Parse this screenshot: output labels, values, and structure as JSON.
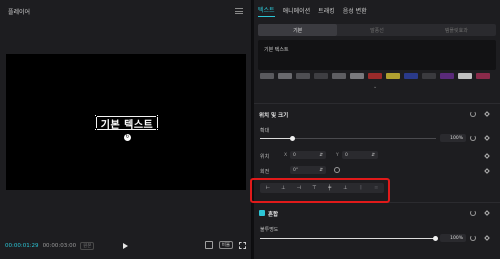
{
  "player": {
    "title": "플레이어",
    "canvas_text": "기본 텍스트",
    "timecode_current": "00:00:01:29",
    "timecode_total": "00:00:03:00",
    "quality_badge": "원본",
    "ratio_label": "비율"
  },
  "panel": {
    "tabs": [
      {
        "label": "텍스트",
        "active": true
      },
      {
        "label": "애니메이션",
        "active": false
      },
      {
        "label": "트래킹",
        "active": false
      },
      {
        "label": "음성 변환",
        "active": false
      }
    ],
    "subtabs": [
      {
        "label": "기본",
        "active": true
      },
      {
        "label": "말풍선",
        "active": false
      },
      {
        "label": "템플릿효과",
        "active": false
      }
    ],
    "text_value": "기본 텍스트",
    "swatch_colors": [
      "#5a5a5e",
      "#6a6a6e",
      "#4e4e52",
      "#3e3e42",
      "#5e5e62",
      "#7a7a7e",
      "#9a2a2a",
      "#b0a030",
      "#2a3a8a",
      "#3a3a3e",
      "#5a2a7a",
      "#c0c0c0",
      "#8a2a4a"
    ],
    "position_size": {
      "title": "위치 및 크기",
      "scale_label": "확대",
      "scale_value": "100%",
      "scale_level": 0.18,
      "position_label": "위치",
      "x_axis": "X",
      "x_value": "0",
      "y_axis": "Y",
      "y_value": "0",
      "rotation_label": "회전",
      "rotation_value": "0°"
    },
    "align_icons": [
      "align-left-icon",
      "align-hcenter-icon",
      "align-right-icon",
      "align-top-icon",
      "align-vcenter-icon",
      "align-bottom-icon",
      "distribute-h-icon",
      "distribute-v-icon"
    ],
    "blend": {
      "title": "혼합",
      "opacity_label": "불투명도",
      "opacity_value": "100%",
      "opacity_level": 1.0
    }
  },
  "colors": {
    "accent": "#2cc6d6",
    "highlight": "#e01a1a"
  }
}
